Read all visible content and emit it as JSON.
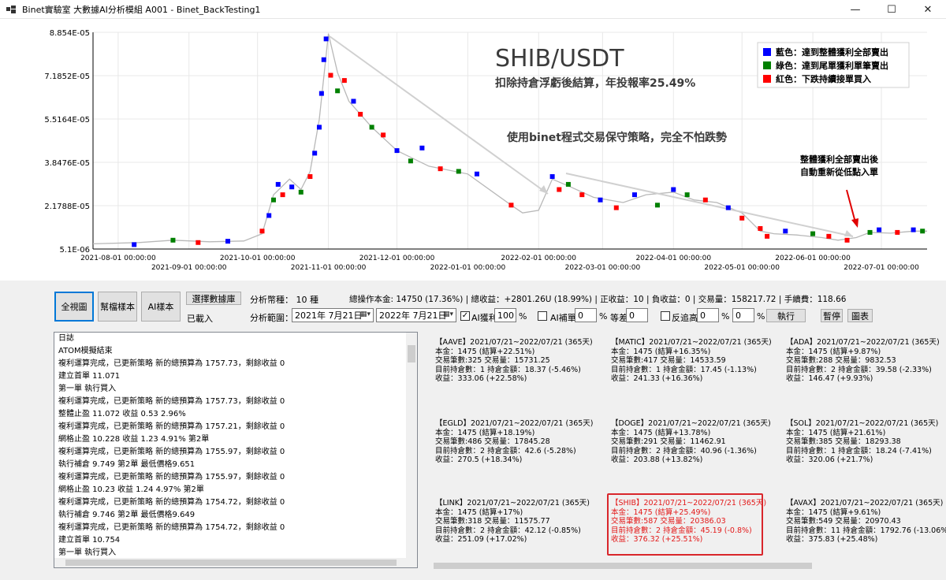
{
  "window": {
    "title": "Binet實驗室  大數據AI分析模組 A001 - Binet_BackTesting1",
    "minimize": "—",
    "maximize": "☐",
    "close": "✕"
  },
  "chart_data": {
    "type": "scatter",
    "title": "SHIB/USDT",
    "subtitle": "扣除持倉浮虧後結算，年投報率25.49%",
    "annotation_main": "使用binet程式交易保守策略，完全不怕跌勢",
    "annotation_arrow_line1": "整體獲利全部賣出後",
    "annotation_arrow_line2": "自動重新從低點入單",
    "y_ticks": [
      "8.854E-05",
      "7.1852E-05",
      "5.5164E-05",
      "3.8476E-05",
      "2.1788E-05",
      "5.1E-06"
    ],
    "y_tick_values": [
      8.854e-05,
      7.1852e-05,
      5.5164e-05,
      3.8476e-05,
      2.1788e-05,
      5.1e-06
    ],
    "ylim": [
      5.1e-06,
      8.854e-05
    ],
    "x_ticks_upper": [
      "2021-08-01 00:00:00",
      "2021-10-01 00:00:00",
      "2021-12-01 00:00:00",
      "2022-02-01 00:00:00",
      "2022-04-01 00:00:00",
      "2022-06-01 00:00:00"
    ],
    "x_ticks_lower": [
      "2021-09-01 00:00:00",
      "2021-11-01 00:00:00",
      "2022-01-01 00:00:00",
      "2022-03-01 00:00:00",
      "2022-05-01 00:00:00",
      "2022-07-01 00:00:00"
    ],
    "legend": [
      {
        "label": "藍色：達到整體獲利全部賣出",
        "color": "#0000ff"
      },
      {
        "label": "綠色：達到尾單獲利單筆賣出",
        "color": "#008000"
      },
      {
        "label": "紅色：下跌持續接單買入",
        "color": "#ff0000"
      }
    ],
    "legend_position": "top-right",
    "grid": true,
    "price_line": {
      "name": "價格",
      "color": "#b8b8b8",
      "x": [
        "2021-07-21",
        "2021-08-10",
        "2021-08-25",
        "2021-09-10",
        "2021-09-25",
        "2021-10-03",
        "2021-10-08",
        "2021-10-15",
        "2021-10-20",
        "2021-10-24",
        "2021-10-28",
        "2021-11-01",
        "2021-11-05",
        "2021-11-10",
        "2021-11-20",
        "2021-12-01",
        "2021-12-15",
        "2022-01-01",
        "2022-01-20",
        "2022-01-25",
        "2022-02-01",
        "2022-02-07",
        "2022-02-15",
        "2022-02-25",
        "2022-03-10",
        "2022-03-20",
        "2022-04-01",
        "2022-04-10",
        "2022-04-20",
        "2022-05-01",
        "2022-05-09",
        "2022-05-15",
        "2022-05-25",
        "2022-06-05",
        "2022-06-12",
        "2022-06-20",
        "2022-06-26",
        "2022-07-05",
        "2022-07-15",
        "2022-07-21"
      ],
      "y": [
        7.1e-06,
        7.6e-06,
        8.5e-06,
        7.9e-06,
        8.2e-06,
        1.1e-05,
        2.6e-05,
        3.2e-05,
        2.8e-05,
        3.5e-05,
        5.5e-05,
        8.8e-05,
        7.3e-05,
        6.2e-05,
        5.2e-05,
        4.3e-05,
        3.7e-05,
        3.4e-05,
        2.2e-05,
        1.9e-05,
        2e-05,
        3.2e-05,
        2.9e-05,
        2.5e-05,
        2.3e-05,
        2.6e-05,
        2.7e-05,
        2.4e-05,
        2.3e-05,
        1.9e-05,
        1.2e-05,
        1.1e-05,
        1.05e-05,
        9.5e-06,
        8.5e-06,
        9.5e-06,
        1.15e-05,
        1.12e-05,
        1.2e-05,
        1.2e-05
      ]
    },
    "trades": [
      {
        "x": "2021-08-08",
        "y": 6.8e-06,
        "c": "b"
      },
      {
        "x": "2021-08-25",
        "y": 8.5e-06,
        "c": "g"
      },
      {
        "x": "2021-09-05",
        "y": 7.6e-06,
        "c": "r"
      },
      {
        "x": "2021-09-18",
        "y": 8.1e-06,
        "c": "b"
      },
      {
        "x": "2021-10-03",
        "y": 1.2e-05,
        "c": "r"
      },
      {
        "x": "2021-10-06",
        "y": 1.8e-05,
        "c": "b"
      },
      {
        "x": "2021-10-08",
        "y": 2.4e-05,
        "c": "g"
      },
      {
        "x": "2021-10-10",
        "y": 3e-05,
        "c": "b"
      },
      {
        "x": "2021-10-12",
        "y": 2.6e-05,
        "c": "r"
      },
      {
        "x": "2021-10-16",
        "y": 2.9e-05,
        "c": "b"
      },
      {
        "x": "2021-10-20",
        "y": 2.7e-05,
        "c": "g"
      },
      {
        "x": "2021-10-24",
        "y": 3.3e-05,
        "c": "r"
      },
      {
        "x": "2021-10-26",
        "y": 4.2e-05,
        "c": "b"
      },
      {
        "x": "2021-10-28",
        "y": 5.2e-05,
        "c": "b"
      },
      {
        "x": "2021-10-29",
        "y": 6.5e-05,
        "c": "b"
      },
      {
        "x": "2021-10-30",
        "y": 7.8e-05,
        "c": "b"
      },
      {
        "x": "2021-10-31",
        "y": 8.6e-05,
        "c": "b"
      },
      {
        "x": "2021-11-02",
        "y": 7.2e-05,
        "c": "r"
      },
      {
        "x": "2021-11-05",
        "y": 6.6e-05,
        "c": "g"
      },
      {
        "x": "2021-11-08",
        "y": 7e-05,
        "c": "r"
      },
      {
        "x": "2021-11-12",
        "y": 6.2e-05,
        "c": "b"
      },
      {
        "x": "2021-11-15",
        "y": 5.7e-05,
        "c": "r"
      },
      {
        "x": "2021-11-20",
        "y": 5.2e-05,
        "c": "g"
      },
      {
        "x": "2021-11-25",
        "y": 4.9e-05,
        "c": "r"
      },
      {
        "x": "2021-12-01",
        "y": 4.3e-05,
        "c": "b"
      },
      {
        "x": "2021-12-07",
        "y": 3.9e-05,
        "c": "g"
      },
      {
        "x": "2021-12-12",
        "y": 4.4e-05,
        "c": "b"
      },
      {
        "x": "2021-12-20",
        "y": 3.6e-05,
        "c": "r"
      },
      {
        "x": "2021-12-28",
        "y": 3.5e-05,
        "c": "g"
      },
      {
        "x": "2022-01-05",
        "y": 3.4e-05,
        "c": "b"
      },
      {
        "x": "2022-01-20",
        "y": 2.2e-05,
        "c": "r"
      },
      {
        "x": "2022-02-07",
        "y": 3.3e-05,
        "c": "b"
      },
      {
        "x": "2022-02-10",
        "y": 2.8e-05,
        "c": "r"
      },
      {
        "x": "2022-02-14",
        "y": 3e-05,
        "c": "g"
      },
      {
        "x": "2022-02-20",
        "y": 2.6e-05,
        "c": "r"
      },
      {
        "x": "2022-02-28",
        "y": 2.4e-05,
        "c": "b"
      },
      {
        "x": "2022-03-07",
        "y": 2.1e-05,
        "c": "r"
      },
      {
        "x": "2022-03-15",
        "y": 2.6e-05,
        "c": "b"
      },
      {
        "x": "2022-03-25",
        "y": 2.2e-05,
        "c": "g"
      },
      {
        "x": "2022-04-01",
        "y": 2.8e-05,
        "c": "b"
      },
      {
        "x": "2022-04-07",
        "y": 2.6e-05,
        "c": "g"
      },
      {
        "x": "2022-04-15",
        "y": 2.4e-05,
        "c": "r"
      },
      {
        "x": "2022-04-25",
        "y": 2.1e-05,
        "c": "b"
      },
      {
        "x": "2022-05-01",
        "y": 1.7e-05,
        "c": "r"
      },
      {
        "x": "2022-05-09",
        "y": 1.3e-05,
        "c": "r"
      },
      {
        "x": "2022-05-12",
        "y": 1e-05,
        "c": "r"
      },
      {
        "x": "2022-05-20",
        "y": 1.2e-05,
        "c": "b"
      },
      {
        "x": "2022-06-01",
        "y": 1.1e-05,
        "c": "g"
      },
      {
        "x": "2022-06-08",
        "y": 1e-05,
        "c": "r"
      },
      {
        "x": "2022-06-16",
        "y": 8.5e-06,
        "c": "r"
      },
      {
        "x": "2022-06-26",
        "y": 1.15e-05,
        "c": "g"
      },
      {
        "x": "2022-06-30",
        "y": 1.25e-05,
        "c": "b"
      },
      {
        "x": "2022-07-08",
        "y": 1.15e-05,
        "c": "r"
      },
      {
        "x": "2022-07-15",
        "y": 1.25e-05,
        "c": "b"
      },
      {
        "x": "2022-07-19",
        "y": 1.2e-05,
        "c": "g"
      }
    ]
  },
  "toolbar": {
    "btn_overview": "全視圖",
    "btn_help": "幫檔樣本",
    "btn_ai": "AI樣本",
    "btn_select_db": "選擇數據庫",
    "loaded_label": "已載入",
    "pairs_label": "分析幣種： 10 種",
    "range_label": "分析範圍：",
    "date_from": "2021年  7月21日",
    "date_to": "2022年  7月21日",
    "summary": "總操作本金: 14750 (17.36%) | 總收益：+2801.26U (18.99%) | 正收益：10 | 負收益：0 | 交易量：158217.72 | 手續費：118.66",
    "ai_profit_label": "AI獲利",
    "ai_profit_value": "100",
    "pct1": "%",
    "ai_fill_label": "AI補單",
    "ai_fill_value": "0",
    "pct2": "%",
    "equal_label": "等差",
    "equal_value": "0",
    "reverse_label": "反追高",
    "reverse_value1": "0",
    "pct3": "%",
    "reverse_value2": "0",
    "pct4": "%",
    "btn_run": "執行",
    "btn_pause": "暫停",
    "btn_chart": "圖表"
  },
  "log": {
    "lines": [
      "日誌",
      "ATOM模擬結束",
      "複利運算完成，已更新策略 新的總預算為 1757.73，剩餘收益 0",
      "建立首單 11.071",
      "第一單 執行買入",
      "複利運算完成，已更新策略 新的總預算為 1757.73，剩餘收益 0",
      "整體止盈 11.072 收益 0.53  2.96%",
      "複利運算完成，已更新策略 新的總預算為 1757.21，剩餘收益 0",
      "網格止盈 10.228 收益 1.23 4.91% 第2單",
      "複利運算完成，已更新策略 新的總預算為 1755.97，剩餘收益 0",
      "執行補倉 9.749 第2單 最低價格9.651",
      "複利運算完成，已更新策略 新的總預算為 1755.97，剩餘收益 0",
      "網格止盈 10.23 收益 1.24 4.97% 第2單",
      "複利運算完成，已更新策略 新的總預算為 1754.72，剩餘收益 0",
      "執行補倉 9.746 第2單 最低價格9.649",
      "複利運算完成，已更新策略 新的總預算為 1754.72，剩餘收益 0",
      "建立首單 10.754",
      "第一單 執行買入",
      "複利運算完成，已更新策略 新的總預算為 1754.72，剩餘收益 0",
      "整體止盈 10.755 收益 0.53  2.96%"
    ]
  },
  "results": [
    {
      "name": "【AAVE】2021/07/21~2022/07/21 (365天)",
      "l1": "本金：1475 (結算+22.51%)",
      "l2": "交易筆數:325  交易量：15731.25",
      "l3": "目前持倉數：1  持倉金額：18.37 (-5.46%)",
      "l4": "收益：333.06 (+22.58%)"
    },
    {
      "name": "【MATIC】2021/07/21~2022/07/21 (365天)",
      "l1": "本金：1475 (結算+16.35%)",
      "l2": "交易筆數:417  交易量：14533.59",
      "l3": "目前持倉數：1  持倉金額：17.45 (-1.13%)",
      "l4": "收益：241.33 (+16.36%)"
    },
    {
      "name": "【ADA】2021/07/21~2022/07/21 (365天)",
      "l1": "本金：1475 (結算+9.87%)",
      "l2": "交易筆數:288  交易量：9832.53",
      "l3": "目前持倉數：2  持倉金額：39.58 (-2.33%)",
      "l4": "收益：146.47 (+9.93%)"
    },
    {
      "name": "【EGLD】2021/07/21~2022/07/21 (365天)",
      "l1": "本金：1475 (結算+18.19%)",
      "l2": "交易筆數:486  交易量：17845.28",
      "l3": "目前持倉數：2  持倉金額：42.6 (-5.28%)",
      "l4": "收益：270.5 (+18.34%)"
    },
    {
      "name": "【DOGE】2021/07/21~2022/07/21 (365天)",
      "l1": "本金：1475 (結算+13.78%)",
      "l2": "交易筆數:291  交易量：11462.91",
      "l3": "目前持倉數：2  持倉金額：40.96 (-1.36%)",
      "l4": "收益：203.88 (+13.82%)"
    },
    {
      "name": "【SOL】2021/07/21~2022/07/21 (365天)",
      "l1": "本金：1475 (結算+21.61%)",
      "l2": "交易筆數:385  交易量：18293.38",
      "l3": "目前持倉數：1  持倉金額：18.24 (-7.41%)",
      "l4": "收益：320.06 (+21.7%)"
    },
    {
      "name": "【LINK】2021/07/21~2022/07/21 (365天)",
      "l1": "本金：1475 (結算+17%)",
      "l2": "交易筆數:318  交易量：11575.77",
      "l3": "目前持倉數：2  持倉金額：42.12 (-0.85%)",
      "l4": "收益：251.09 (+17.02%)"
    },
    {
      "name": "【SHIB】2021/07/21~2022/07/21 (365天)",
      "l1": "本金：1475 (結算+25.49%)",
      "l2": "交易筆數:587  交易量：20386.03",
      "l3": "目前持倉數：2  持倉金額：45.19 (-0.8%)",
      "l4": "收益：376.32 (+25.51%)"
    },
    {
      "name": "【AVAX】2021/07/21~2022/07/21 (365天)",
      "l1": "本金：1475 (結算+9.61%)",
      "l2": "交易筆數:549  交易量：20970.43",
      "l3": "目前持倉數：11  持倉金額：1792.76 (-13.06%)",
      "l4": "收益：375.83 (+25.48%)"
    }
  ]
}
